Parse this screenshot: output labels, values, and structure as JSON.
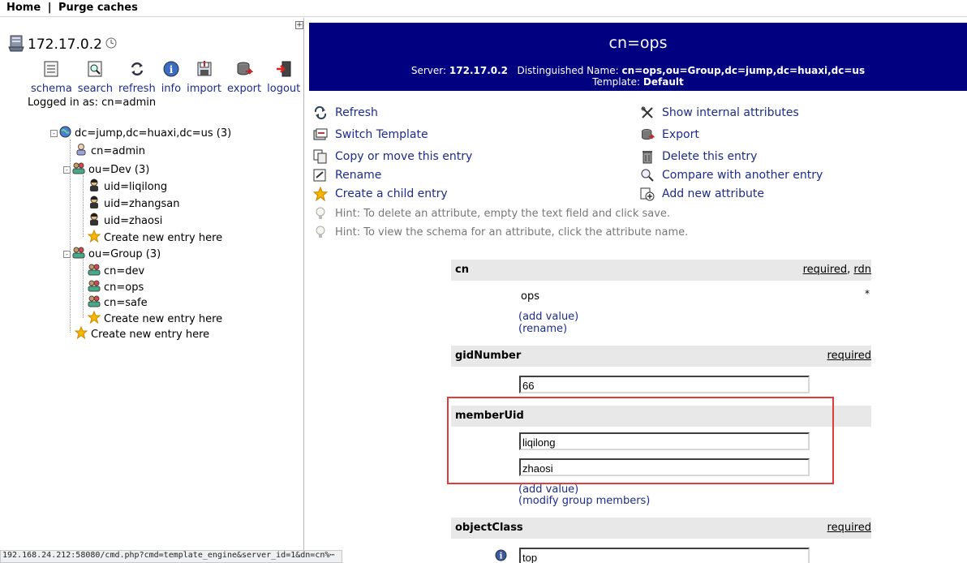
{
  "topbar": {
    "home": "Home",
    "separator": "|",
    "purge": "Purge caches"
  },
  "server": {
    "name": "172.17.0.2",
    "expand_glyph": "+"
  },
  "toolbar": [
    {
      "label": "schema",
      "icon": "schema-icon"
    },
    {
      "label": "search",
      "icon": "search-icon"
    },
    {
      "label": "refresh",
      "icon": "refresh-icon"
    },
    {
      "label": "info",
      "icon": "info-icon"
    },
    {
      "label": "import",
      "icon": "import-icon"
    },
    {
      "label": "export",
      "icon": "export-icon"
    },
    {
      "label": "logout",
      "icon": "logout-icon"
    }
  ],
  "logged_in": "Logged in as: cn=admin",
  "tree": {
    "root": "dc=jump,dc=huaxi,dc=us (3)",
    "admin": "cn=admin",
    "dev": "ou=Dev (3)",
    "dev_children": [
      "uid=liqilong",
      "uid=zhangsan",
      "uid=zhaosi"
    ],
    "group": "ou=Group (3)",
    "group_children": [
      "cn=dev",
      "cn=ops",
      "cn=safe"
    ],
    "create_new": "Create new entry here",
    "expand_minus": "-"
  },
  "statusbar": "192.168.24.212:58080/cmd.php?cmd=template_engine&server_id=1&dn=cn%⋯",
  "header": {
    "title": "cn=ops",
    "server_label": "Server:",
    "server_value": "172.17.0.2",
    "dn_label": "Distinguished Name:",
    "dn_value": "cn=ops,ou=Group,dc=jump,dc=huaxi,dc=us",
    "template_label": "Template:",
    "template_value": "Default"
  },
  "actions_left": [
    "Refresh",
    "Switch Template",
    "Copy or move this entry",
    "Rename",
    "Create a child entry"
  ],
  "actions_right": [
    "Show internal attributes",
    "Export",
    "Delete this entry",
    "Compare with another entry",
    "Add new attribute"
  ],
  "hints": [
    "Hint: To delete an attribute, empty the text field and click save.",
    "Hint: To view the schema for an attribute, click the attribute name."
  ],
  "attributes": {
    "cn": {
      "name": "cn",
      "required": "required",
      "comma": ",",
      "rdn": "rdn",
      "value": "ops",
      "star": "*",
      "add_value": "(add value)",
      "rename": "(rename)"
    },
    "gid": {
      "name": "gidNumber",
      "required": "required",
      "value": "66"
    },
    "member": {
      "name": "memberUid",
      "values": [
        "liqilong",
        "zhaosi"
      ],
      "add_value": "(add value)",
      "modify": "(modify group members)"
    },
    "oc": {
      "name": "objectClass",
      "required": "required",
      "value": "top"
    }
  },
  "colors": {
    "header_bg": "#000080",
    "link": "#1c2c8a",
    "highlight_box": "#e03c3c",
    "attr_head_bg": "#e8e8e8"
  }
}
